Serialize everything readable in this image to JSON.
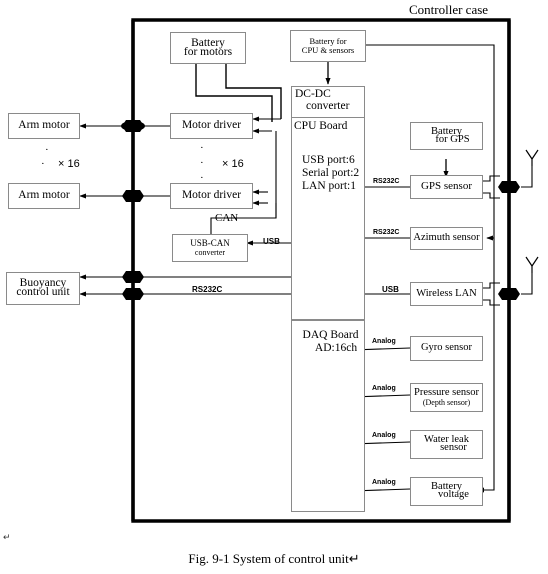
{
  "figure": {
    "caption": "Fig. 9-1 System of control unit↵",
    "case_title": "Controller case",
    "page_mark": "↵"
  },
  "boxes": {
    "arm_motor_top": {
      "line1": "Arm motor",
      "line2": ""
    },
    "arm_motor_bottom": {
      "line1": "Arm motor",
      "line2": ""
    },
    "buoyancy": {
      "line1": "Buoyancy",
      "line2": "control unit"
    },
    "battery_motors": {
      "line1": "Battery",
      "line2": "for motors"
    },
    "motor_driver_top": {
      "line1": "Motor driver",
      "line2": ""
    },
    "motor_driver_bottom": {
      "line1": "Motor driver",
      "line2": ""
    },
    "usb_can": {
      "line1": "USB-CAN",
      "line2": "converter"
    },
    "battery_cpu": {
      "line1": "Battery for",
      "line2": "CPU & sensors"
    },
    "battery_gps": {
      "line1": "Battery",
      "line2": "for GPS"
    },
    "gps_sensor": {
      "line1": "GPS sensor",
      "line2": ""
    },
    "azimuth_sensor": {
      "line1": "Azimuth sensor",
      "line2": ""
    },
    "wireless_lan": {
      "line1": "Wireless LAN",
      "line2": ""
    },
    "gyro_sensor": {
      "line1": "Gyro sensor",
      "line2": ""
    },
    "pressure_sensor": {
      "line1": "Pressure sensor",
      "line2": "(Depth sensor)"
    },
    "water_leak": {
      "line1": "Water leak",
      "line2": "sensor"
    },
    "battery_voltage": {
      "line1": "Battery",
      "line2": "voltage"
    }
  },
  "cpu_column": {
    "dcdc_line1": "DC-DC",
    "dcdc_line2": "converter",
    "cpu_board": "CPU Board",
    "ports": "USB port:6\nSerial port:2\nLAN port:1",
    "ports_lines": [
      "USB port:6",
      "Serial port:2",
      "LAN port:1"
    ],
    "daq_line1": "DAQ Board",
    "daq_line2": "AD:16ch"
  },
  "bus_labels": {
    "can": "CAN",
    "usb_to_converter": "USB",
    "rs232c_buoyancy": "RS232C",
    "rs232c_gps": "RS232C",
    "rs232c_azimuth": "RS232C",
    "usb_wlan": "USB",
    "analog_gyro": "Analog",
    "analog_pressure": "Analog",
    "analog_waterleak": "Analog",
    "analog_battery": "Analog"
  },
  "multipliers": {
    "arm_motor_count": "× 16",
    "motor_driver_count": "× 16",
    "dots": "·"
  },
  "icons": {
    "antenna_top": "antenna-icon",
    "antenna_bottom": "antenna-icon",
    "connectors": [
      "cable-penetrator-icon",
      "cable-penetrator-icon",
      "cable-penetrator-icon",
      "cable-penetrator-icon",
      "cable-penetrator-icon",
      "cable-penetrator-icon"
    ]
  },
  "colors": {
    "line": "#000000",
    "box_border": "#8a8a8a",
    "case_border": "#000000",
    "background": "#ffffff"
  }
}
